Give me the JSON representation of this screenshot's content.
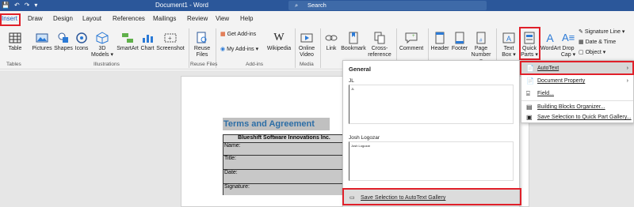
{
  "titlebar": {
    "qat": [
      "💾",
      "↶",
      "↷",
      "▾"
    ],
    "doc_title": "Document1 - Word",
    "search_placeholder": "Search"
  },
  "tabs": [
    "Insert",
    "Draw",
    "Design",
    "Layout",
    "References",
    "Mailings",
    "Review",
    "View",
    "Help"
  ],
  "ribbon": {
    "buttons": {
      "table": "Table",
      "pictures": "Pictures",
      "shapes": "Shapes",
      "icons": "Icons",
      "models3d": "3D",
      "models3d_2": "Models ▾",
      "smartart": "SmartArt",
      "chart": "Chart",
      "screenshot": "Screenshot",
      "reuse": "Reuse",
      "reuse2": "Files",
      "getaddins": "Get Add-ins",
      "myaddins": "My Add-ins ▾",
      "wikipedia": "Wikipedia",
      "onlinevideo": "Online",
      "onlinevideo2": "Video",
      "link": "Link",
      "bookmark": "Bookmark",
      "crossref": "Cross-",
      "crossref2": "reference",
      "comment": "Comment",
      "header": "Header",
      "footer": "Footer",
      "pagenum": "Page",
      "pagenum2": "Number ▾",
      "textbox": "Text",
      "textbox2": "Box ▾",
      "quickparts": "Quick",
      "quickparts2": "Parts ▾",
      "wordart": "WordArt",
      "dropcap": "Drop",
      "dropcap2": "Cap ▾",
      "sigline": "Signature Line ▾",
      "datetime": "Date & Time",
      "object": "Object ▾"
    },
    "groups": {
      "tables": "Tables",
      "illustrations": "Illustrations",
      "reuse": "Reuse Files",
      "addins": "Add-ins",
      "media": "Media"
    }
  },
  "document": {
    "title": "Terms and Agreement",
    "company": "Blueshift Software Innovations Inc.",
    "fields": [
      "Name:",
      "Title:",
      "Date:",
      "Signature:"
    ]
  },
  "gallery": {
    "section": "General",
    "item1_label": "JL",
    "item1_preview": "JL",
    "item2_label": "Josh Logozar",
    "item2_preview": "Josh Logozar",
    "save_label": "Save Selection to AutoText Gallery"
  },
  "menu": {
    "items": [
      {
        "label": "AutoText",
        "icon": "📄",
        "arrow": "›"
      },
      {
        "label": "Document Property",
        "icon": "📄",
        "arrow": "›"
      },
      {
        "label": "Field...",
        "icon": "⌸",
        "arrow": ""
      },
      {
        "label": "Building Blocks Organizer...",
        "icon": "▤",
        "arrow": ""
      },
      {
        "label": "Save Selection to Quick Part Gallery...",
        "icon": "▣",
        "arrow": ""
      }
    ]
  },
  "colors": {
    "titlebar": "#2b579a",
    "highlight": "#e0202a",
    "title_text": "#2d6ea6"
  }
}
